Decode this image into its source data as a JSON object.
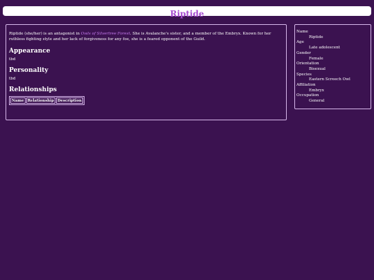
{
  "page_title": "Riptide",
  "intro": {
    "part1": "Riptide (she/her) is an antagonist in ",
    "book_title": "Owls of Silvertree Forest",
    "part2": ". She is Avalanche's sister, and a member of the Embryx. Known for her ruthless fighting style and her lack of forgiveness for any foe, she is a feared opponent of the Guild."
  },
  "sections": {
    "appearance": {
      "heading": "Appearance",
      "body": "tbd"
    },
    "personality": {
      "heading": "Personality",
      "body": "tbd"
    },
    "relationships": {
      "heading": "Relationships"
    }
  },
  "relationships_table": {
    "headers": [
      "Name",
      "Relationship",
      "Description"
    ]
  },
  "infobox": [
    {
      "label": "Name",
      "value": "Riptide"
    },
    {
      "label": "Age",
      "value": "Late adolescent"
    },
    {
      "label": "Gender",
      "value": "Female"
    },
    {
      "label": "Orientation",
      "value": "Bisexual"
    },
    {
      "label": "Species",
      "value": "Eastern Screech Owl"
    },
    {
      "label": "Affiliation",
      "value": "Embryx"
    },
    {
      "label": "Occupation",
      "value": "General"
    }
  ],
  "colors": {
    "background": "#3b1250",
    "accent": "#a64cd0",
    "border": "#d8b8ec"
  }
}
